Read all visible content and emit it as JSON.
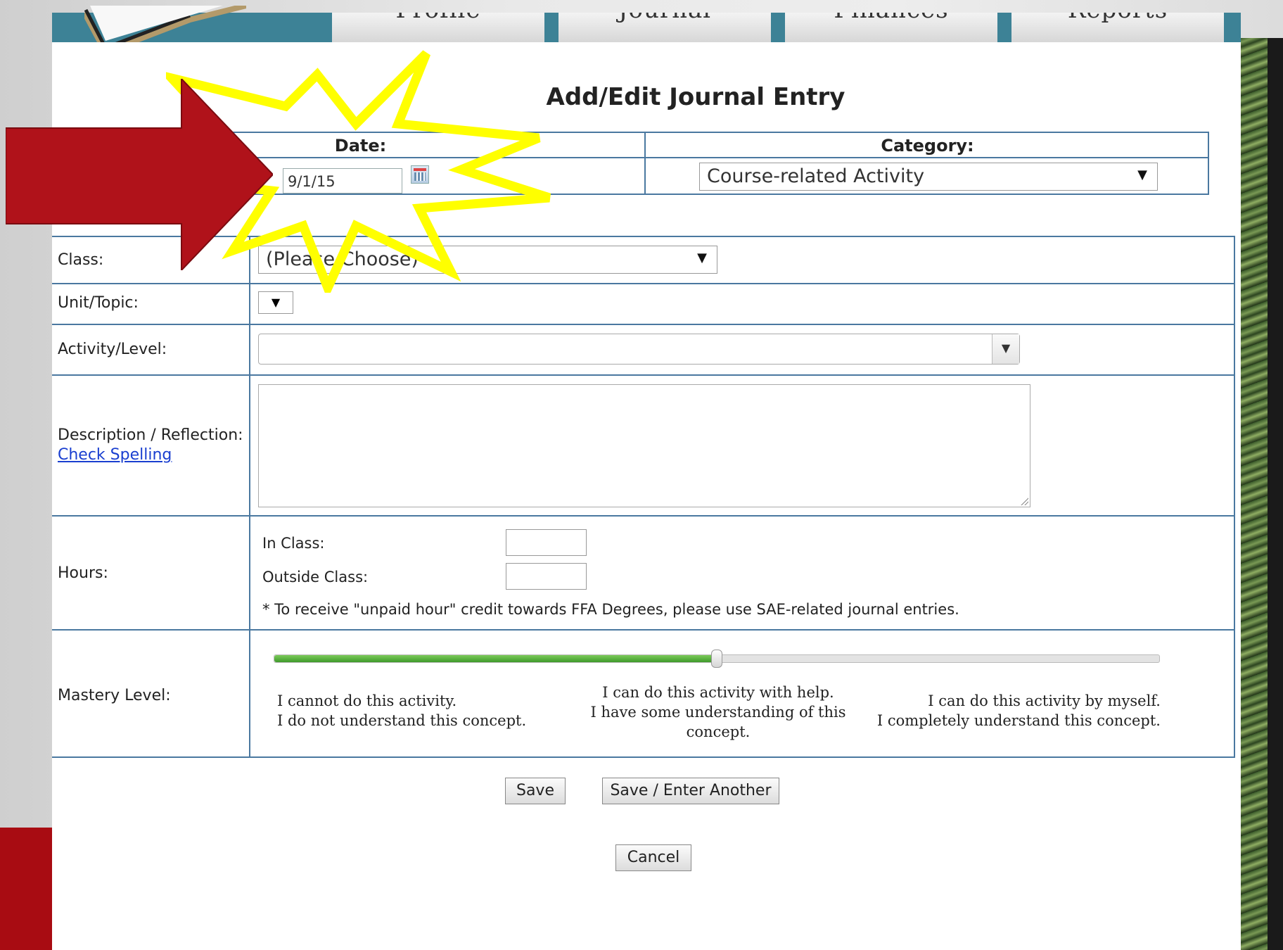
{
  "nav": {
    "tabs": [
      "Profile",
      "Journal",
      "Finances",
      "Reports"
    ]
  },
  "form": {
    "title": "Add/Edit Journal Entry",
    "date_label": "Date:",
    "date_value": "9/1/15",
    "category_label": "Category:",
    "category_value": "Course-related Activity",
    "class_label": "Class:",
    "class_value": "(Please Choose)",
    "unit_label": "Unit/Topic:",
    "activity_label": "Activity/Level:",
    "description_label": "Description / Reflection:",
    "check_spelling": "Check Spelling",
    "hours_label": "Hours:",
    "in_class_label": "In Class:",
    "outside_class_label": "Outside Class:",
    "hours_note": "* To receive \"unpaid hour\" credit towards FFA Degrees, please use SAE-related journal entries.",
    "mastery_label": "Mastery Level:",
    "mastery_value_fraction": 0.5,
    "mastery_low_line1": "I cannot do this activity.",
    "mastery_low_line2": "I do not understand this concept.",
    "mastery_mid_line1": "I can do this activity with help.",
    "mastery_mid_line2": "I have some understanding of this",
    "mastery_mid_line3": "concept.",
    "mastery_high_line1": "I can do this activity by myself.",
    "mastery_high_line2": "I completely understand this concept."
  },
  "buttons": {
    "save": "Save",
    "save_another": "Save / Enter Another",
    "cancel": "Cancel"
  },
  "icons": {
    "calendar": "calendar-icon",
    "dropdown": "chevron-down-icon"
  },
  "colors": {
    "border": "#4a78a0",
    "slider_fill": "#4caf2f",
    "annotation_arrow": "#b0121a",
    "annotation_star": "#ffff00",
    "nav_bar": "#3d8296"
  }
}
